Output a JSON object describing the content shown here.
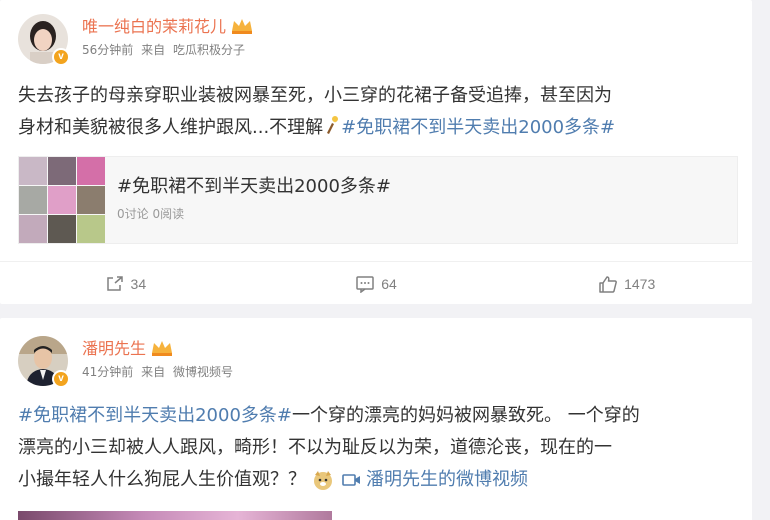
{
  "posts": [
    {
      "author": "唯一纯白的茉莉花儿",
      "time": "56分钟前",
      "source_prefix": "来自",
      "source": "吃瓜积极分子",
      "text_line1": "失去孩子的母亲穿职业装被网暴至死，小三穿的花裙子备受追捧，甚至因为",
      "text_line2": "身材和美貌被很多人维护跟风...不理解",
      "topic": "#免职裙不到半天卖出2000多条#",
      "share_card": {
        "title": "#免职裙不到半天卖出2000多条#",
        "stats": "0讨论 0阅读"
      },
      "actions": {
        "repost": "34",
        "comment": "64",
        "like": "1473"
      }
    },
    {
      "author": "潘明先生",
      "time": "41分钟前",
      "source_prefix": "来自",
      "source": "微博视频号",
      "topic": "#免职裙不到半天卖出2000多条#",
      "text_after_topic": "一个穿的漂亮的妈妈被网暴致死。 一个穿的",
      "text_line2": "漂亮的小三却被人人跟风，畸形！不以为耻反以为荣，道德沦丧，现在的一",
      "text_line3": "小撮年轻人什么狗屁人生价值观？？",
      "video_link": "潘明先生的微博视频"
    }
  ],
  "colors": {
    "name": "#eb7350",
    "topic": "#507daf",
    "meta": "#808080",
    "badge": "#f3a41e"
  },
  "icons": [
    "v-badge-icon",
    "crown-icon",
    "thinking-emoji-icon",
    "repost-icon",
    "comment-icon",
    "like-icon",
    "doge-emoji-icon",
    "video-icon"
  ]
}
